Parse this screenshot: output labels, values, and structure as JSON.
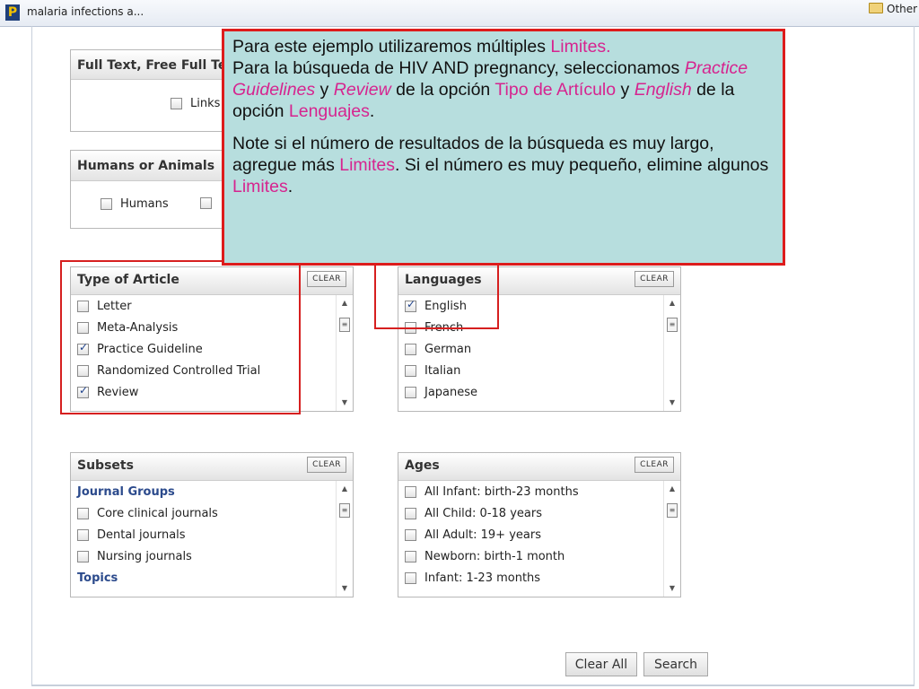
{
  "bookmark_bar": {
    "logo_letter": "P",
    "tab_label": "malaria infections a...",
    "other_label": "Other"
  },
  "fulltext": {
    "title": "Full Text, Free Full Te",
    "option": "Links"
  },
  "humans": {
    "title": "Humans or Animals",
    "option_humans": "Humans"
  },
  "type_of_article": {
    "title": "Type of Article",
    "clear_label": "CLEAR",
    "items": [
      {
        "label": "Letter",
        "checked": false
      },
      {
        "label": "Meta-Analysis",
        "checked": false
      },
      {
        "label": "Practice Guideline",
        "checked": true
      },
      {
        "label": "Randomized Controlled Trial",
        "checked": false
      },
      {
        "label": "Review",
        "checked": true
      }
    ]
  },
  "languages": {
    "title": "Languages",
    "clear_label": "CLEAR",
    "items": [
      {
        "label": "English",
        "checked": true
      },
      {
        "label": "French",
        "checked": false
      },
      {
        "label": "German",
        "checked": false
      },
      {
        "label": "Italian",
        "checked": false
      },
      {
        "label": "Japanese",
        "checked": false
      }
    ]
  },
  "subsets": {
    "title": "Subsets",
    "clear_label": "CLEAR",
    "group_header": "Journal Groups",
    "items": [
      {
        "label": "Core clinical journals",
        "checked": false
      },
      {
        "label": "Dental journals",
        "checked": false
      },
      {
        "label": "Nursing journals",
        "checked": false
      }
    ],
    "partial_header": "Topics"
  },
  "ages": {
    "title": "Ages",
    "clear_label": "CLEAR",
    "items": [
      {
        "label": "All Infant: birth-23 months",
        "checked": false
      },
      {
        "label": "All Child: 0-18 years",
        "checked": false
      },
      {
        "label": "All Adult: 19+ years",
        "checked": false
      },
      {
        "label": "Newborn: birth-1 month",
        "checked": false
      },
      {
        "label": "Infant: 1-23 months",
        "checked": false
      }
    ]
  },
  "buttons": {
    "clear_all": "Clear All",
    "search": "Search"
  },
  "callout": {
    "p1": {
      "t1": "Para este ejemplo utilizaremos múltiples ",
      "h1": "Limites.",
      "t2": "Para la búsqueda de HIV AND pregnancy, seleccionamos ",
      "h2": "Practice Guidelines",
      "t3": " y ",
      "h3": "Review",
      "t4": " de la opción  ",
      "h4": "Tipo de Artículo",
      "t5": " y ",
      "h5": "English",
      "t6": " de la opción ",
      "h6": "Lenguajes",
      "t7": "."
    },
    "p2": {
      "t1": "Note si el número de resultados de la búsqueda es muy largo, agregue más ",
      "h1": "Limites",
      "t2": ".  Si el número es muy pequeño, elimine algunos ",
      "h2": "Limites",
      "t3": "."
    }
  },
  "colors": {
    "callout_bg": "#b7dede",
    "highlight_border": "#dd1c1c",
    "highlight_text": "#d6248f"
  }
}
